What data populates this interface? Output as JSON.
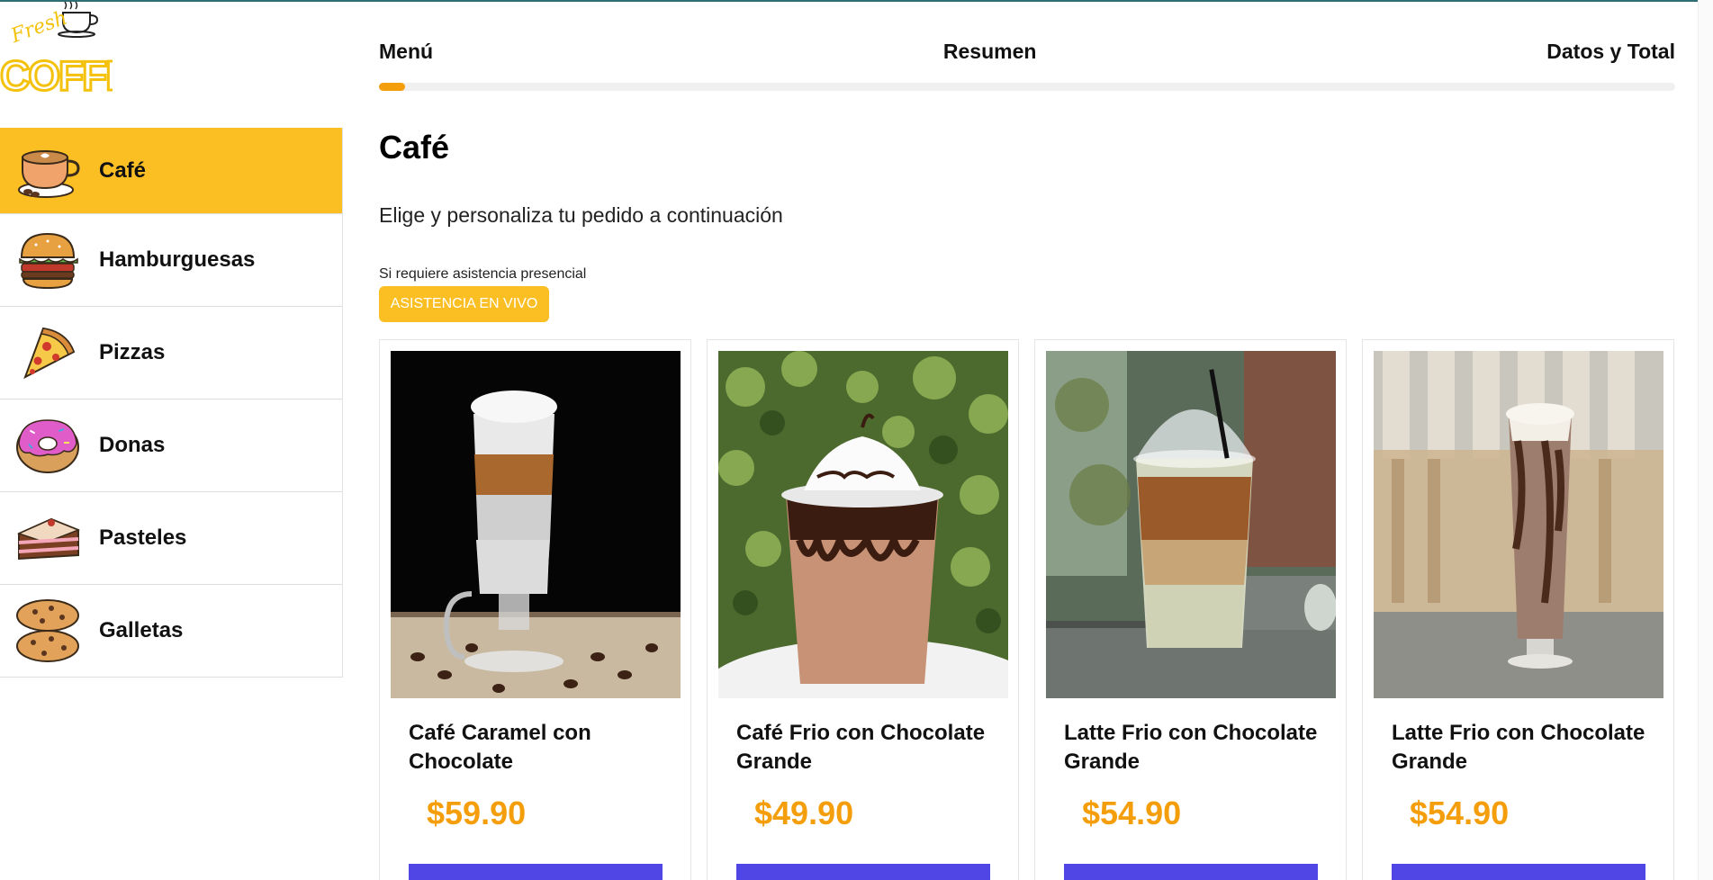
{
  "brand": {
    "top_word": "Fresh",
    "main_word": "COFFEE",
    "color": "#f4c20d"
  },
  "sidebar": {
    "items": [
      {
        "label": "Café",
        "icon": "coffee-cup-icon",
        "active": true
      },
      {
        "label": "Hamburguesas",
        "icon": "burger-icon",
        "active": false
      },
      {
        "label": "Pizzas",
        "icon": "pizza-icon",
        "active": false
      },
      {
        "label": "Donas",
        "icon": "donut-icon",
        "active": false
      },
      {
        "label": "Pasteles",
        "icon": "cake-icon",
        "active": false
      },
      {
        "label": "Galletas",
        "icon": "cookies-icon",
        "active": false
      }
    ]
  },
  "steps": {
    "menu": "Menú",
    "summary": "Resumen",
    "total": "Datos y Total",
    "progress_percent": 2
  },
  "main": {
    "title": "Café",
    "subtitle": "Elige y personaliza tu pedido a continuación",
    "assist_note": "Si requiere asistencia presencial",
    "assist_button": "ASISTENCIA EN VIVO"
  },
  "products": [
    {
      "name": "Café Caramel con Chocolate",
      "price": "$59.90",
      "image": "caramel-coffee-photo"
    },
    {
      "name": "Café Frio con Chocolate Grande",
      "price": "$49.90",
      "image": "frappe-chocolate-photo"
    },
    {
      "name": "Latte Frio con Chocolate Grande",
      "price": "$54.90",
      "image": "iced-latte-photo"
    },
    {
      "name": "Latte Frio con Chocolate Grande",
      "price": "$54.90",
      "image": "chocolate-shake-photo"
    }
  ],
  "colors": {
    "accent": "#fbbf24",
    "price": "#f59e0b",
    "button": "#4f46e5"
  }
}
